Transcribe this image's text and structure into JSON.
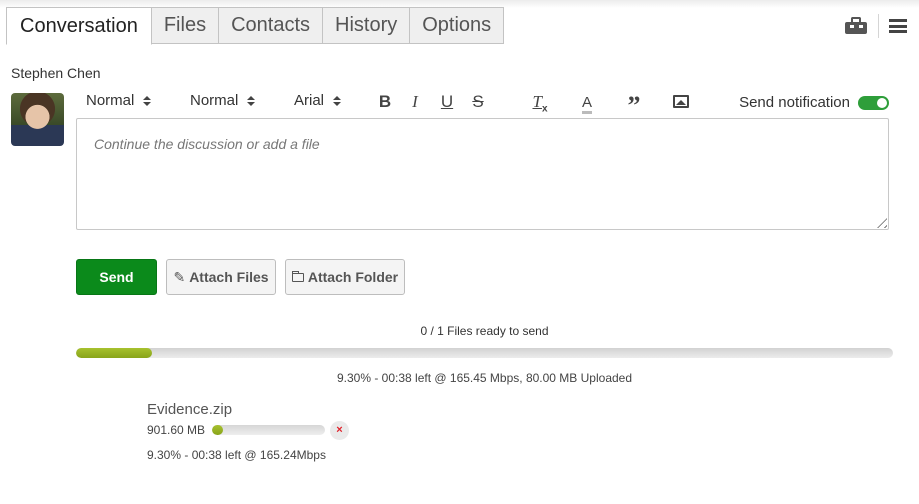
{
  "tabs": [
    {
      "label": "Conversation",
      "active": true
    },
    {
      "label": "Files",
      "active": false
    },
    {
      "label": "Contacts",
      "active": false
    },
    {
      "label": "History",
      "active": false
    },
    {
      "label": "Options",
      "active": false
    }
  ],
  "header_icons": [
    "toolbox-icon",
    "menu-icon"
  ],
  "author": {
    "name": "Stephen Chen",
    "avatar": "user-photo"
  },
  "toolbar": {
    "heading_select": "Normal",
    "size_select": "Normal",
    "font_select": "Arial",
    "buttons": {
      "bold": "B",
      "italic": "I",
      "underline": "U",
      "strike": "S",
      "clear_format": "T",
      "clear_format_sub": "x",
      "text_color": "A",
      "quote": "”",
      "image": "image-icon"
    },
    "send_notification_label": "Send notification",
    "send_notification_on": true,
    "toggle_color": "#2e9e3a"
  },
  "editor": {
    "placeholder": "Continue the discussion or add a file",
    "value": ""
  },
  "actions": {
    "send_label": "Send",
    "attach_files_label": "Attach Files",
    "attach_files_icon": "✎",
    "attach_folder_label": "Attach Folder",
    "send_color": "#0b8a1b"
  },
  "upload": {
    "ready_text": "0 / 1 Files ready to send",
    "overall_progress_percent": 9.3,
    "overall_status": "9.30% - 00:38 left @ 165.45 Mbps, 80.00 MB Uploaded",
    "progress_color": "#9ab525",
    "files": [
      {
        "name": "Evidence.zip",
        "size": "901.60 MB",
        "progress_percent": 9.3,
        "status": "9.30% - 00:38 left @ 165.24Mbps",
        "remove_label": "×"
      }
    ]
  }
}
